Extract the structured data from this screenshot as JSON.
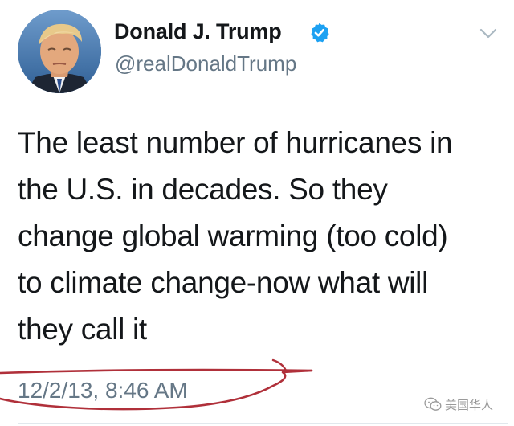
{
  "author": {
    "name": "Donald J. Trump",
    "handle": "@realDonaldTrump",
    "verified": true
  },
  "tweet": {
    "text_lines": [
      "The least number of hurricanes in",
      "the U.S. in decades. So they",
      "change global warming (too cold)",
      "to climate change-now what will",
      "they call it"
    ],
    "timestamp": "12/2/13, 8:46 AM"
  },
  "watermark": {
    "text": "美国华人"
  },
  "colors": {
    "verified_badge": "#1da1f2",
    "text_primary": "#14171a",
    "text_secondary": "#657786",
    "annotation_ink": "#b0303a"
  },
  "icons": {
    "verified": "verified-badge-icon",
    "menu": "chevron-down-icon",
    "watermark": "wechat-icon"
  }
}
